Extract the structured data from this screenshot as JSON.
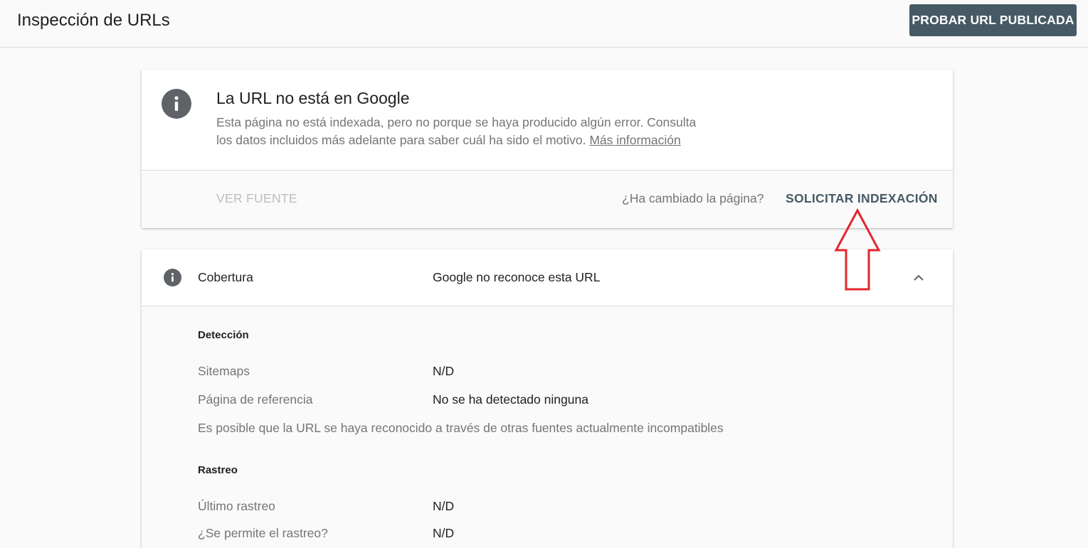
{
  "header": {
    "title": "Inspección de URLs",
    "test_live_url_label": "PROBAR URL PUBLICADA",
    "test_live_url_color": "#455a64"
  },
  "status_card": {
    "icon": "info-icon",
    "title": "La URL no está en Google",
    "description_line1": "Esta página no está indexada, pero no porque se haya producido algún error. Consulta",
    "description_line2": "los datos incluidos más adelante para saber cuál ha sido el motivo.",
    "more_info_label": "Más información",
    "view_source_label": "VER FUENTE",
    "changed_question": "¿Ha cambiado la página?",
    "request_indexing_label": "SOLICITAR INDEXACIÓN"
  },
  "coverage": {
    "icon": "info-icon",
    "label": "Cobertura",
    "status": "Google no reconoce esta URL",
    "collapse_icon": "chevron-up-icon",
    "sections": {
      "detection": {
        "title": "Detección",
        "sitemaps_label": "Sitemaps",
        "sitemaps_value": "N/D",
        "referring_page_label": "Página de referencia",
        "referring_page_value": "No se ha detectado ninguna",
        "note": "Es posible que la URL se haya reconocido a través de otras fuentes actualmente incompatibles"
      },
      "crawl": {
        "title": "Rastreo",
        "last_crawl_label": "Último rastreo",
        "last_crawl_value": "N/D",
        "crawl_allowed_label": "¿Se permite el rastreo?",
        "crawl_allowed_value": "N/D"
      }
    }
  },
  "annotation": {
    "icon": "red-arrow-up-icon",
    "color": "#e3262e"
  }
}
